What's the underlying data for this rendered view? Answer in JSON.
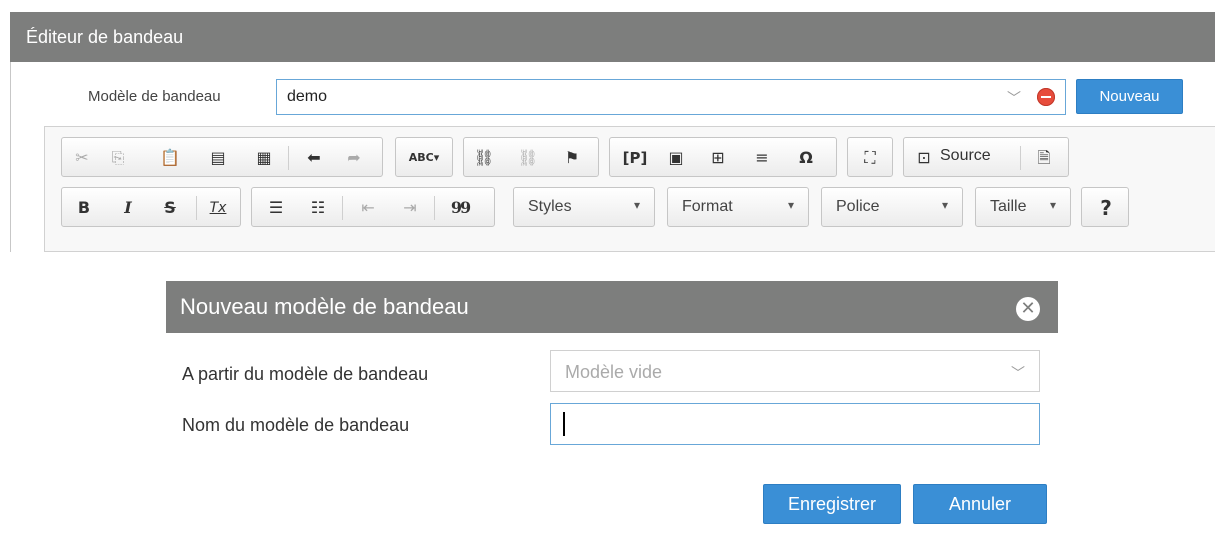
{
  "editor_panel": {
    "title": "Éditeur de bandeau",
    "model_label": "Modèle de bandeau",
    "model_value": "demo",
    "new_button": "Nouveau"
  },
  "toolbar": {
    "row1_icons": [
      "cut-icon",
      "copy-icon",
      "paste-icon",
      "paste-text-icon",
      "paste-word-icon",
      "undo-icon",
      "redo-icon",
      "spellcheck-icon",
      "link-icon",
      "unlink-icon",
      "anchor-icon",
      "placeholder-icon",
      "image-icon",
      "table-icon",
      "horizontal-rule-icon",
      "special-char-icon",
      "maximize-icon",
      "source-icon",
      "templates-icon"
    ],
    "spellcheck_glyph": "ABC",
    "placeholder_glyph": "[P]",
    "source_label": "Source",
    "row2": {
      "bold": "B",
      "italic": "I",
      "strike": "S",
      "remove_format": "Tx",
      "blockquote": "99",
      "help": "?"
    },
    "combos": [
      "Styles",
      "Format",
      "Police",
      "Taille"
    ]
  },
  "dialog": {
    "title": "Nouveau modèle de bandeau",
    "from_label": "A partir du modèle de bandeau",
    "from_placeholder": "Modèle vide",
    "name_label": "Nom du modèle de bandeau",
    "name_value": "",
    "save_button": "Enregistrer",
    "cancel_button": "Annuler"
  },
  "colors": {
    "header_gray": "#7d7e7d",
    "accent_blue": "#3a8fd6",
    "focus_border": "#68a7d8",
    "clear_red": "#e74c3c"
  }
}
